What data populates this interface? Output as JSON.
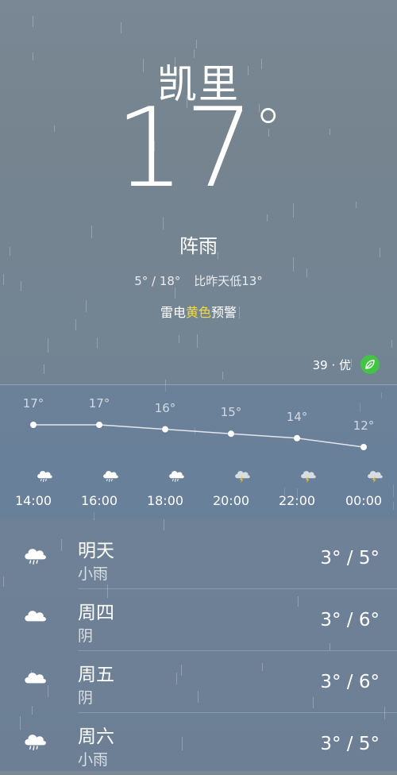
{
  "header": {
    "city": "凯里",
    "temperature": "17",
    "degree_symbol": "°",
    "condition": "阵雨",
    "range": "5° / 18°",
    "compare": "比昨天低13°",
    "warning_pre": "雷电",
    "warning_highlight": "黄色",
    "warning_post": "预警",
    "aqi": "39 · 优"
  },
  "hourly": [
    {
      "time": "14:00",
      "temp": "17°",
      "value": 17,
      "icon": "rain-cloud-icon"
    },
    {
      "time": "16:00",
      "temp": "17°",
      "value": 17,
      "icon": "rain-cloud-icon"
    },
    {
      "time": "18:00",
      "temp": "16°",
      "value": 16,
      "icon": "rain-cloud-icon"
    },
    {
      "time": "20:00",
      "temp": "15°",
      "value": 15,
      "icon": "thunder-cloud-icon"
    },
    {
      "time": "22:00",
      "temp": "14°",
      "value": 14,
      "icon": "thunder-cloud-icon"
    },
    {
      "time": "00:00",
      "temp": "12°",
      "value": 12,
      "icon": "thunder-cloud-icon"
    }
  ],
  "daily": [
    {
      "name": "明天",
      "desc": "小雨",
      "temp": "3° / 5°",
      "icon": "rain-cloud-icon"
    },
    {
      "name": "周四",
      "desc": "阴",
      "temp": "3° / 6°",
      "icon": "cloud-icon"
    },
    {
      "name": "周五",
      "desc": "阴",
      "temp": "3° / 6°",
      "icon": "cloud-icon"
    },
    {
      "name": "周六",
      "desc": "小雨",
      "temp": "3° / 5°",
      "icon": "rain-cloud-icon"
    }
  ]
}
